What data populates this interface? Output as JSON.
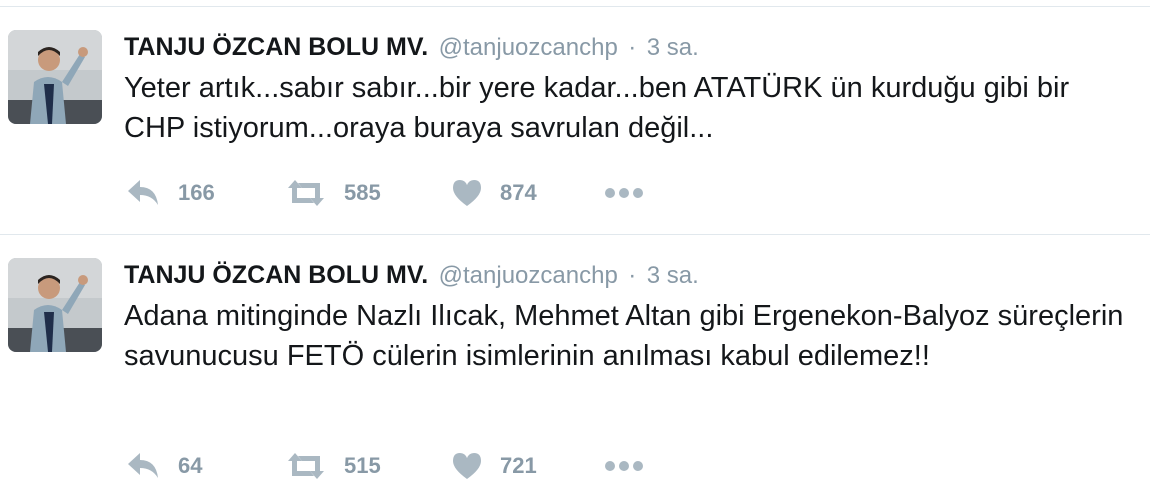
{
  "tweets": [
    {
      "author_name": "TANJU ÖZCAN BOLU MV.",
      "handle": "@tanjuozcanchp",
      "separator": "·",
      "time": "3 sa.",
      "text": "Yeter artık...sabır sabır...bir yere kadar...ben ATATÜRK ün kurduğu gibi bir CHP istiyorum...oraya buraya savrulan değil...",
      "reply_count": "166",
      "retweet_count": "585",
      "like_count": "874"
    },
    {
      "author_name": "TANJU ÖZCAN BOLU MV.",
      "handle": "@tanjuozcanchp",
      "separator": "·",
      "time": "3 sa.",
      "text": "Adana mitinginde Nazlı Ilıcak, Mehmet Altan gibi Ergenekon-Balyoz süreçlerin savunucusu FETÖ cülerin isimlerinin anılması kabul edilemez!!",
      "reply_count": "64",
      "retweet_count": "515",
      "like_count": "721"
    }
  ],
  "colors": {
    "text": "#14171a",
    "muted": "#8899a6",
    "action_icon": "#aab8c2",
    "divider": "#e1e8ed"
  },
  "icons": [
    "reply-icon",
    "retweet-icon",
    "like-icon",
    "more-icon"
  ]
}
